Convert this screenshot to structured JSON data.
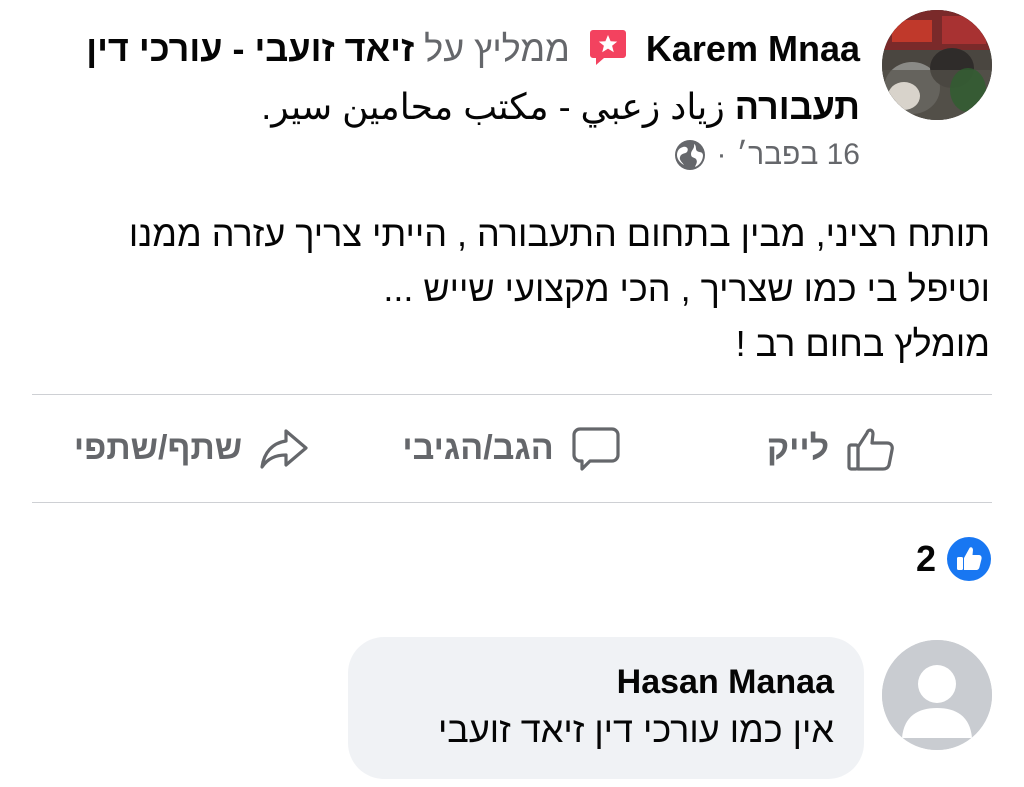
{
  "post": {
    "author": "Karem Mnaa",
    "recommend_text": "ממליץ על",
    "page_name_bold": "זיאד זועבי - עורכי דין תעבורה",
    "page_name_rest": "زياد زعبي -  مكتب محامين سير.",
    "date": "16 בפבר׳",
    "separator": "·",
    "body_lines": [
      "תותח רציני, מבין בתחום התעבורה , הייתי צריך עזרה ממנו",
      "וטיפל בי כמו שצריך , הכי מקצועי שייש ...",
      "מומלץ בחום רב !"
    ]
  },
  "actions": {
    "like_label": "לייק",
    "comment_label": "הגב/הגיבי",
    "share_label": "שתף/שתפי"
  },
  "reactions": {
    "count": "2"
  },
  "comment": {
    "author": "Hasan Manaa",
    "text": "אין כמו עורכי דין זיאד זועבי"
  },
  "colors": {
    "accent_blue": "#1877f2",
    "recommend_red": "#f3425f",
    "muted_text": "#65676b",
    "bubble_bg": "#f0f2f5"
  },
  "icons": {
    "recommend": "recommend-star-icon",
    "audience": "globe-icon",
    "like": "thumbs-up-icon",
    "comment": "speech-bubble-icon",
    "share": "share-arrow-icon",
    "reaction": "like-reaction-icon"
  }
}
